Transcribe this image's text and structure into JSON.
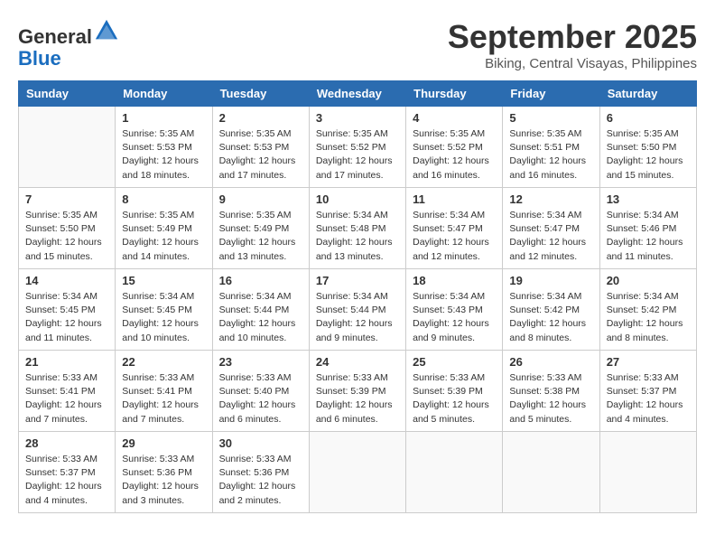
{
  "header": {
    "logo_line1": "General",
    "logo_line2": "Blue",
    "month_title": "September 2025",
    "location": "Biking, Central Visayas, Philippines"
  },
  "weekdays": [
    "Sunday",
    "Monday",
    "Tuesday",
    "Wednesday",
    "Thursday",
    "Friday",
    "Saturday"
  ],
  "weeks": [
    [
      {
        "day": "",
        "info": ""
      },
      {
        "day": "1",
        "info": "Sunrise: 5:35 AM\nSunset: 5:53 PM\nDaylight: 12 hours\nand 18 minutes."
      },
      {
        "day": "2",
        "info": "Sunrise: 5:35 AM\nSunset: 5:53 PM\nDaylight: 12 hours\nand 17 minutes."
      },
      {
        "day": "3",
        "info": "Sunrise: 5:35 AM\nSunset: 5:52 PM\nDaylight: 12 hours\nand 17 minutes."
      },
      {
        "day": "4",
        "info": "Sunrise: 5:35 AM\nSunset: 5:52 PM\nDaylight: 12 hours\nand 16 minutes."
      },
      {
        "day": "5",
        "info": "Sunrise: 5:35 AM\nSunset: 5:51 PM\nDaylight: 12 hours\nand 16 minutes."
      },
      {
        "day": "6",
        "info": "Sunrise: 5:35 AM\nSunset: 5:50 PM\nDaylight: 12 hours\nand 15 minutes."
      }
    ],
    [
      {
        "day": "7",
        "info": "Sunrise: 5:35 AM\nSunset: 5:50 PM\nDaylight: 12 hours\nand 15 minutes."
      },
      {
        "day": "8",
        "info": "Sunrise: 5:35 AM\nSunset: 5:49 PM\nDaylight: 12 hours\nand 14 minutes."
      },
      {
        "day": "9",
        "info": "Sunrise: 5:35 AM\nSunset: 5:49 PM\nDaylight: 12 hours\nand 13 minutes."
      },
      {
        "day": "10",
        "info": "Sunrise: 5:34 AM\nSunset: 5:48 PM\nDaylight: 12 hours\nand 13 minutes."
      },
      {
        "day": "11",
        "info": "Sunrise: 5:34 AM\nSunset: 5:47 PM\nDaylight: 12 hours\nand 12 minutes."
      },
      {
        "day": "12",
        "info": "Sunrise: 5:34 AM\nSunset: 5:47 PM\nDaylight: 12 hours\nand 12 minutes."
      },
      {
        "day": "13",
        "info": "Sunrise: 5:34 AM\nSunset: 5:46 PM\nDaylight: 12 hours\nand 11 minutes."
      }
    ],
    [
      {
        "day": "14",
        "info": "Sunrise: 5:34 AM\nSunset: 5:45 PM\nDaylight: 12 hours\nand 11 minutes."
      },
      {
        "day": "15",
        "info": "Sunrise: 5:34 AM\nSunset: 5:45 PM\nDaylight: 12 hours\nand 10 minutes."
      },
      {
        "day": "16",
        "info": "Sunrise: 5:34 AM\nSunset: 5:44 PM\nDaylight: 12 hours\nand 10 minutes."
      },
      {
        "day": "17",
        "info": "Sunrise: 5:34 AM\nSunset: 5:44 PM\nDaylight: 12 hours\nand 9 minutes."
      },
      {
        "day": "18",
        "info": "Sunrise: 5:34 AM\nSunset: 5:43 PM\nDaylight: 12 hours\nand 9 minutes."
      },
      {
        "day": "19",
        "info": "Sunrise: 5:34 AM\nSunset: 5:42 PM\nDaylight: 12 hours\nand 8 minutes."
      },
      {
        "day": "20",
        "info": "Sunrise: 5:34 AM\nSunset: 5:42 PM\nDaylight: 12 hours\nand 8 minutes."
      }
    ],
    [
      {
        "day": "21",
        "info": "Sunrise: 5:33 AM\nSunset: 5:41 PM\nDaylight: 12 hours\nand 7 minutes."
      },
      {
        "day": "22",
        "info": "Sunrise: 5:33 AM\nSunset: 5:41 PM\nDaylight: 12 hours\nand 7 minutes."
      },
      {
        "day": "23",
        "info": "Sunrise: 5:33 AM\nSunset: 5:40 PM\nDaylight: 12 hours\nand 6 minutes."
      },
      {
        "day": "24",
        "info": "Sunrise: 5:33 AM\nSunset: 5:39 PM\nDaylight: 12 hours\nand 6 minutes."
      },
      {
        "day": "25",
        "info": "Sunrise: 5:33 AM\nSunset: 5:39 PM\nDaylight: 12 hours\nand 5 minutes."
      },
      {
        "day": "26",
        "info": "Sunrise: 5:33 AM\nSunset: 5:38 PM\nDaylight: 12 hours\nand 5 minutes."
      },
      {
        "day": "27",
        "info": "Sunrise: 5:33 AM\nSunset: 5:37 PM\nDaylight: 12 hours\nand 4 minutes."
      }
    ],
    [
      {
        "day": "28",
        "info": "Sunrise: 5:33 AM\nSunset: 5:37 PM\nDaylight: 12 hours\nand 4 minutes."
      },
      {
        "day": "29",
        "info": "Sunrise: 5:33 AM\nSunset: 5:36 PM\nDaylight: 12 hours\nand 3 minutes."
      },
      {
        "day": "30",
        "info": "Sunrise: 5:33 AM\nSunset: 5:36 PM\nDaylight: 12 hours\nand 2 minutes."
      },
      {
        "day": "",
        "info": ""
      },
      {
        "day": "",
        "info": ""
      },
      {
        "day": "",
        "info": ""
      },
      {
        "day": "",
        "info": ""
      }
    ]
  ]
}
